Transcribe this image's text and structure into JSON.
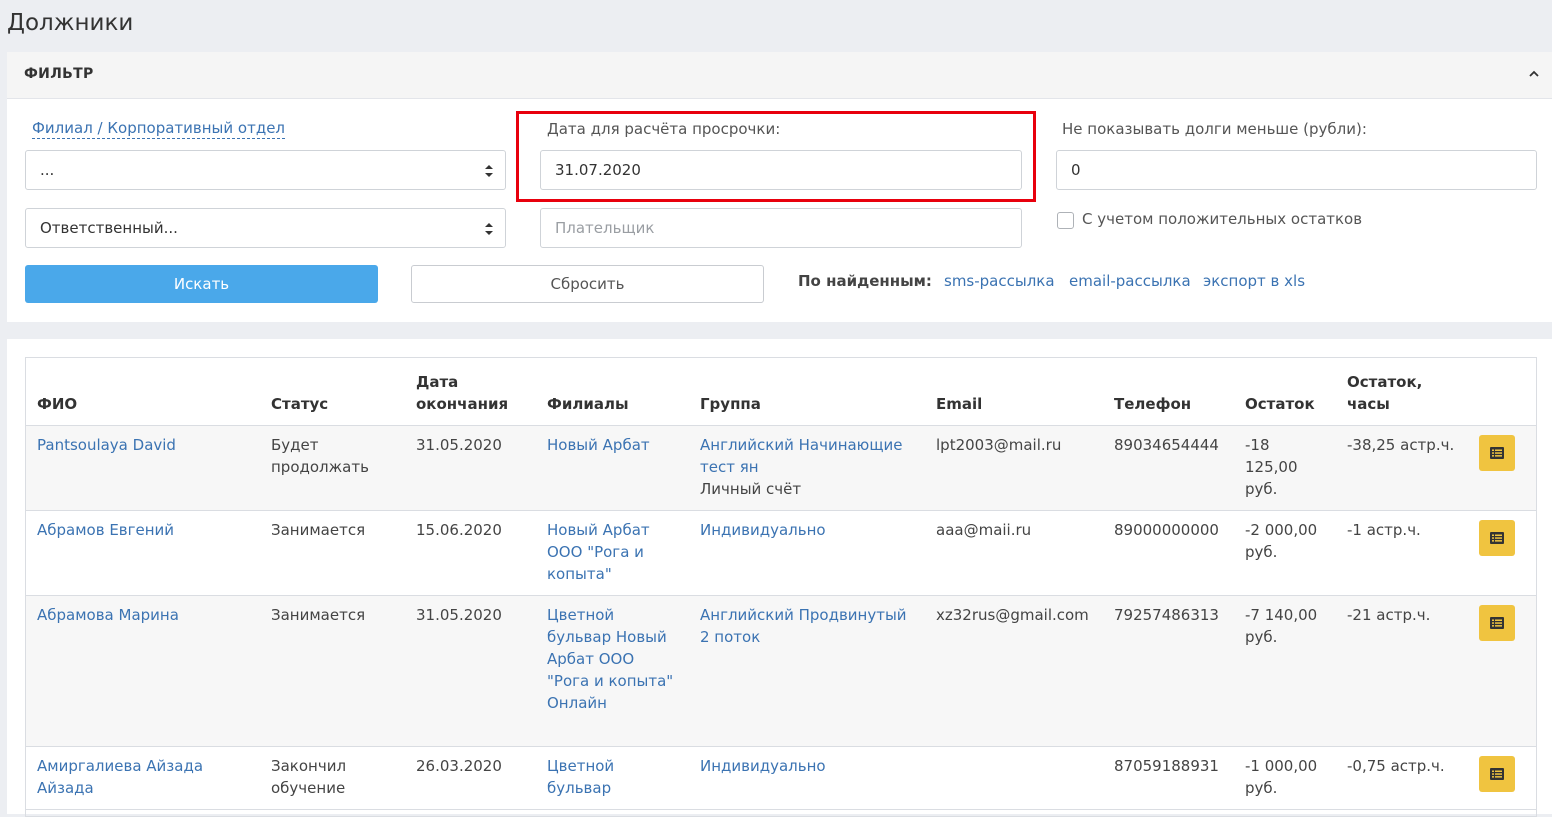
{
  "page": {
    "title": "Должники"
  },
  "filter": {
    "header": "ФИЛЬТР",
    "branch_label": "Филиал / Корпоративный отдел",
    "branch_value": "...",
    "responsible_value": "Ответственный...",
    "overdue_date_label": "Дата для расчёта просрочки:",
    "overdue_date_value": "31.07.2020",
    "payer_placeholder": "Плательщик",
    "min_debt_label": "Не показывать долги меньше (рубли):",
    "min_debt_value": "0",
    "positive_balance_label": "С учетом положительных остатков",
    "search_button": "Искать",
    "reset_button": "Сбросить",
    "found_label": "По найденным:",
    "links": [
      "sms-рассылка",
      "email-рассылка",
      "экспорт в xls"
    ]
  },
  "table": {
    "headers": {
      "name": "ФИО",
      "status": "Статус",
      "end_date": "Дата окончания",
      "branches": "Филиалы",
      "group": "Группа",
      "email": "Email",
      "phone": "Телефон",
      "balance": "Остаток",
      "balance_hours": "Остаток, часы"
    },
    "rows": [
      {
        "name": "Pantsoulaya David",
        "status": "Будет продолжать",
        "end_date": "31.05.2020",
        "branches": "Новый Арбат",
        "group_link": "Английский Начинающие тест ян",
        "group_text": "Личный счёт",
        "email": "lpt2003@mail.ru",
        "phone": "89034654444",
        "balance": "-18 125,00 руб.",
        "balance_hours": "-38,25 астр.ч."
      },
      {
        "name": "Абрамов Евгений",
        "status": "Занимается",
        "end_date": "15.06.2020",
        "branches": "Новый Арбат ООО \"Рога и копыта\"",
        "group_link": "Индивидуально",
        "group_text": "",
        "email": "aaa@maii.ru",
        "phone": "89000000000",
        "balance": "-2 000,00 руб.",
        "balance_hours": "-1 астр.ч."
      },
      {
        "name": "Абрамова Марина",
        "status": "Занимается",
        "end_date": "31.05.2020",
        "branches": "Цветной бульвар Новый Арбат ООО \"Рога и копыта\" Онлайн",
        "group_link": "Английский Продвинутый 2 поток",
        "group_text": "",
        "email": "xz32rus@gmail.com",
        "phone": "79257486313",
        "balance": "-7 140,00 руб.",
        "balance_hours": "-21 астр.ч."
      },
      {
        "name": "Амиргалиева Айзада Айзада",
        "status": "Закончил обучение",
        "end_date": "26.03.2020",
        "branches": "Цветной бульвар",
        "group_link": "Индивидуально",
        "group_text": "",
        "email": "",
        "phone": "87059188931",
        "balance": "-1 000,00 руб.",
        "balance_hours": "-0,75 астр.ч."
      }
    ]
  },
  "colors": {
    "accent": "#4aa8ea",
    "link": "#3b73b2",
    "action": "#f0c440",
    "highlight": "#e8000d"
  },
  "icons": {
    "collapse": "chevron-up-icon",
    "select": "select-arrows-icon",
    "row_action": "list-icon"
  }
}
